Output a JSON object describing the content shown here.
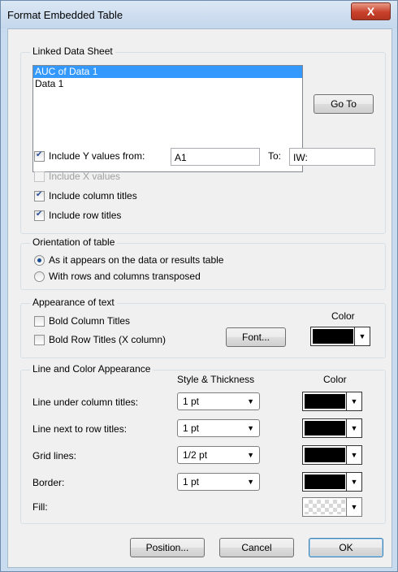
{
  "window": {
    "title": "Format Embedded Table",
    "close_label": "X"
  },
  "linked": {
    "group_title": "Linked Data Sheet",
    "items": [
      "AUC of Data 1",
      "Data 1"
    ],
    "selected_index": 0,
    "goto_label": "Go To",
    "include_y_label": "Include Y values from:",
    "include_y_checked": true,
    "from_value": "A1",
    "to_label": "To:",
    "to_value": "IW:",
    "include_x_label": "Include X values",
    "include_x_checked": false,
    "include_x_enabled": false,
    "include_col_label": "Include column titles",
    "include_col_checked": true,
    "include_row_label": "Include row titles",
    "include_row_checked": true
  },
  "orientation": {
    "group_title": "Orientation of table",
    "option1": "As it appears on the data or results table",
    "option2": "With rows and columns transposed",
    "selected": 1
  },
  "text_appearance": {
    "group_title": "Appearance of text",
    "bold_col_label": "Bold Column Titles",
    "bold_col_checked": false,
    "bold_row_label": "Bold Row Titles (X column)",
    "bold_row_checked": false,
    "color_label": "Color",
    "font_label": "Font...",
    "text_color": "#000000"
  },
  "line_color": {
    "group_title": "Line and Color Appearance",
    "style_header": "Style & Thickness",
    "color_header": "Color",
    "rows": [
      {
        "label": "Line under column titles:",
        "style": "1 pt",
        "color": "#000000"
      },
      {
        "label": "Line next to row titles:",
        "style": "1 pt",
        "color": "#000000"
      },
      {
        "label": "Grid lines:",
        "style": "1/2 pt",
        "color": "#000000"
      },
      {
        "label": "Border:",
        "style": "1 pt",
        "color": "#000000"
      }
    ],
    "fill_label": "Fill:",
    "fill_pattern": "checker-disabled"
  },
  "buttons": {
    "position": "Position...",
    "cancel": "Cancel",
    "ok": "OK"
  }
}
